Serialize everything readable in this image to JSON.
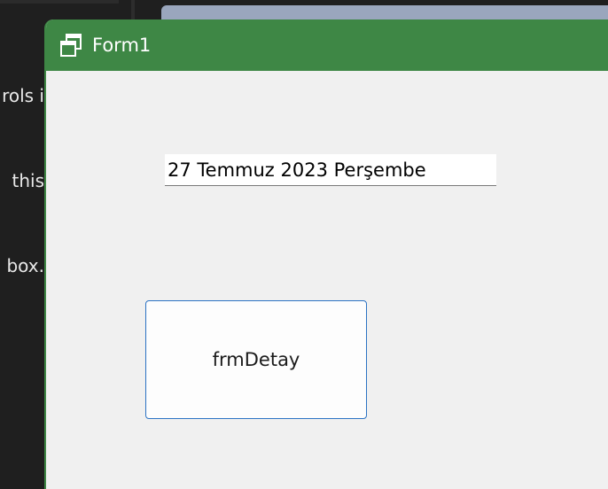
{
  "background": {
    "text_lines": [
      "rols i",
      "this",
      "box."
    ]
  },
  "window": {
    "title": "Form1",
    "icon": "windows-form-icon",
    "titlebar_color": "#3e8745"
  },
  "form": {
    "date_value": "27 Temmuz 2023 Perşembe",
    "detail_button_label": "frmDetay"
  }
}
